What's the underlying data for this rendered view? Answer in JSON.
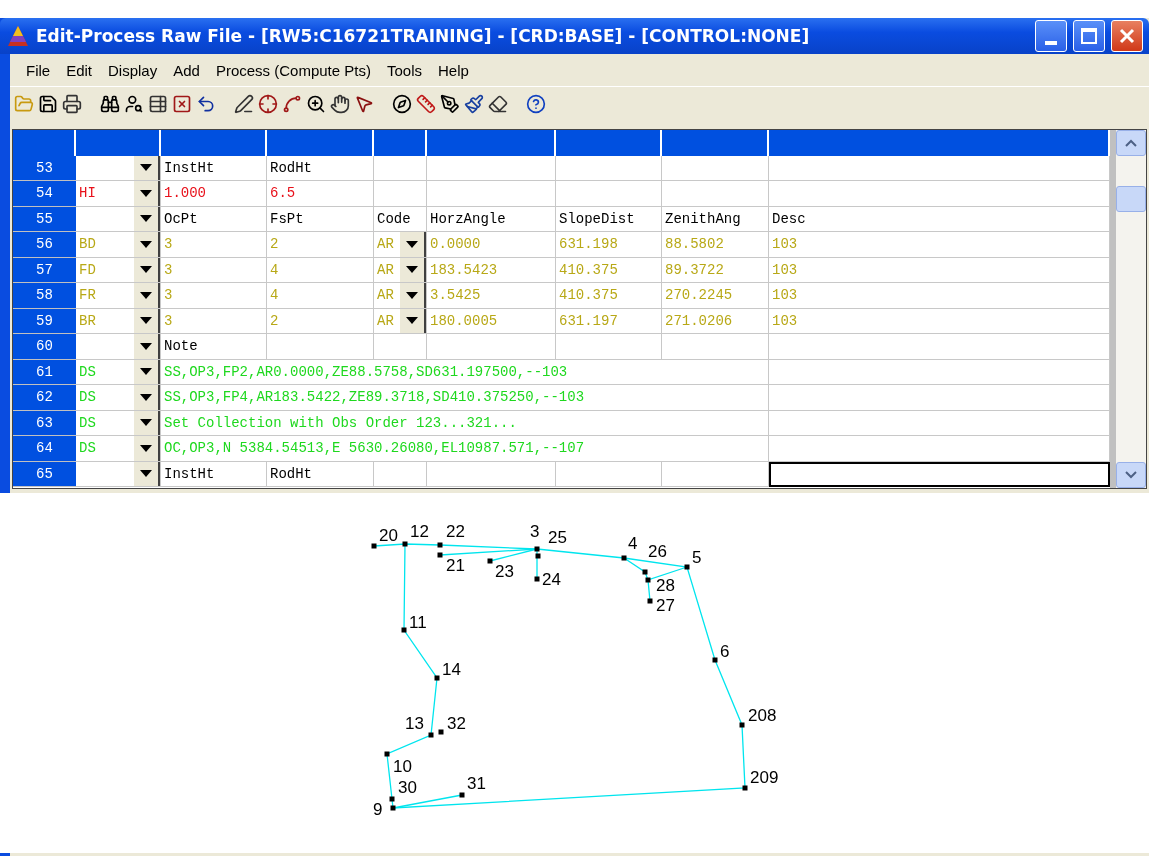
{
  "window": {
    "title": "Edit-Process Raw File - [RW5:C16721TRAINING] - [CRD:BASE] - [CONTROL:NONE]"
  },
  "menu": [
    "File",
    "Edit",
    "Display",
    "Add",
    "Process (Compute Pts)",
    "Tools",
    "Help"
  ],
  "grid": {
    "rows": [
      {
        "number": "53",
        "type": "",
        "color": "#000000",
        "kind": "cells",
        "cells": [
          "InstHt",
          "RodHt",
          "",
          "",
          "",
          "",
          ""
        ],
        "code_dropdown": false,
        "current": false
      },
      {
        "number": "54",
        "type": "HI",
        "color": "#e8101a",
        "kind": "cells",
        "cells": [
          "1.000",
          "6.5",
          "",
          "",
          "",
          "",
          ""
        ],
        "code_dropdown": false,
        "current": false
      },
      {
        "number": "55",
        "type": "",
        "color": "#000000",
        "kind": "cells",
        "cells": [
          "OcPt",
          "FsPt",
          "Code",
          "HorzAngle",
          "SlopeDist",
          "ZenithAng",
          "Desc"
        ],
        "code_dropdown": false,
        "current": false
      },
      {
        "number": "56",
        "type": "BD",
        "color": "#b8a816",
        "kind": "cells",
        "cells": [
          "3",
          "2",
          "AR",
          "0.0000",
          "631.198",
          "88.5802",
          "103"
        ],
        "code_dropdown": true,
        "current": false
      },
      {
        "number": "57",
        "type": "FD",
        "color": "#b8a816",
        "kind": "cells",
        "cells": [
          "3",
          "4",
          "AR",
          "183.5423",
          "410.375",
          "89.3722",
          "103"
        ],
        "code_dropdown": true,
        "current": false
      },
      {
        "number": "58",
        "type": "FR",
        "color": "#b8a816",
        "kind": "cells",
        "cells": [
          "3",
          "4",
          "AR",
          "3.5425",
          "410.375",
          "270.2245",
          "103"
        ],
        "code_dropdown": true,
        "current": false
      },
      {
        "number": "59",
        "type": "BR",
        "color": "#b8a816",
        "kind": "cells",
        "cells": [
          "3",
          "2",
          "AR",
          "180.0005",
          "631.197",
          "271.0206",
          "103"
        ],
        "code_dropdown": true,
        "current": false
      },
      {
        "number": "60",
        "type": "",
        "color": "#000000",
        "kind": "cells",
        "cells": [
          "Note",
          "",
          "",
          "",
          "",
          "",
          ""
        ],
        "code_dropdown": false,
        "current": false
      },
      {
        "number": "61",
        "type": "DS",
        "color": "#1ed81e",
        "kind": "span",
        "text": "SS,OP3,FP2,AR0.0000,ZE88.5758,SD631.197500,--103",
        "current": false
      },
      {
        "number": "62",
        "type": "DS",
        "color": "#1ed81e",
        "kind": "span",
        "text": "SS,OP3,FP4,AR183.5422,ZE89.3718,SD410.375250,--103",
        "current": false
      },
      {
        "number": "63",
        "type": "DS",
        "color": "#1ed81e",
        "kind": "span",
        "text": "Set Collection with Obs Order 123...321...",
        "current": false
      },
      {
        "number": "64",
        "type": "DS",
        "color": "#1ed81e",
        "kind": "span",
        "text": "OC,OP3,N 5384.54513,E 5630.26080,EL10987.571,--107",
        "current": false
      },
      {
        "number": "65",
        "type": "",
        "color": "#000000",
        "kind": "cells",
        "cells": [
          "InstHt",
          "RodHt",
          "",
          "",
          "",
          "",
          ""
        ],
        "code_dropdown": false,
        "current": true
      }
    ]
  },
  "plot": {
    "points": [
      "20",
      "12",
      "22",
      "21",
      "23",
      "3",
      "25",
      "24",
      "4",
      "26",
      "28",
      "27",
      "5",
      "11",
      "6",
      "14",
      "13",
      "32",
      "10",
      "30",
      "9",
      "31",
      "208",
      "209"
    ]
  }
}
